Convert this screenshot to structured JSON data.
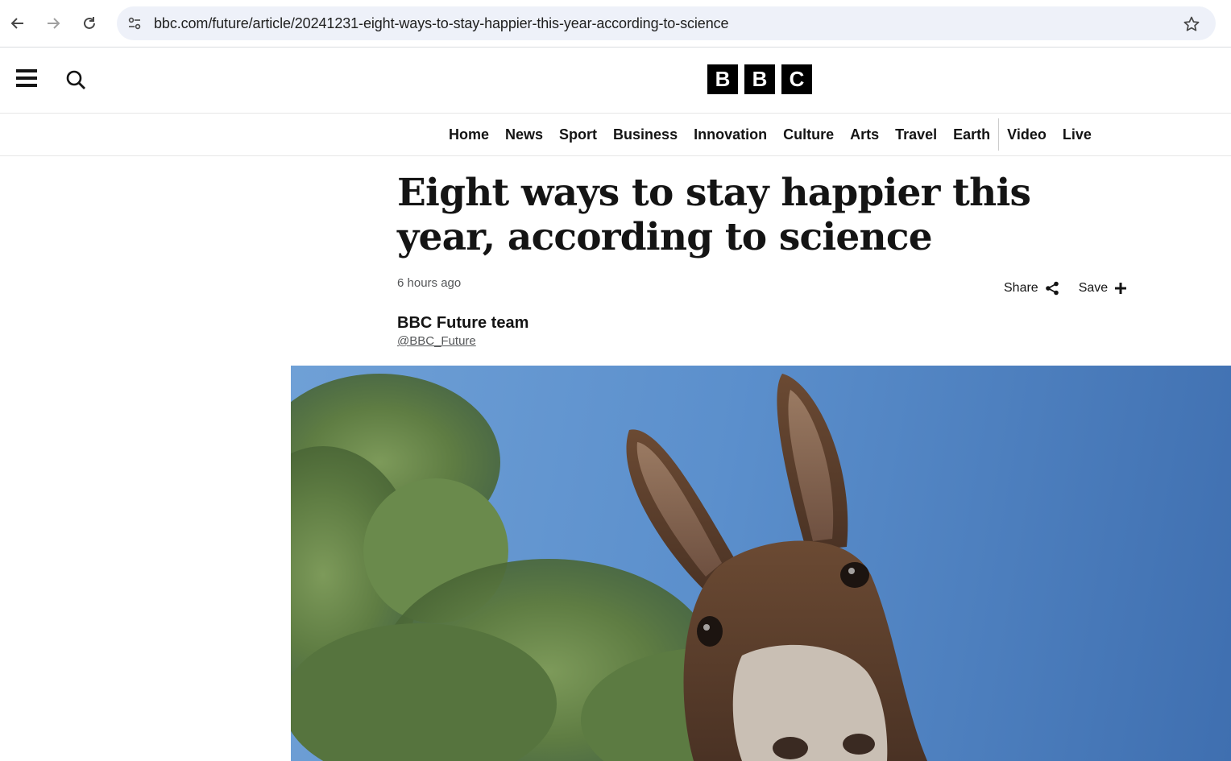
{
  "browser": {
    "url": "bbc.com/future/article/20241231-eight-ways-to-stay-happier-this-year-according-to-science",
    "icons": [
      "back-arrow-icon",
      "forward-arrow-icon",
      "reload-icon",
      "site-info-icon",
      "bookmark-star-icon"
    ]
  },
  "header": {
    "logo_letters": [
      "B",
      "B",
      "C"
    ],
    "icons": [
      "hamburger-menu-icon",
      "search-icon"
    ]
  },
  "nav": {
    "items": [
      "Home",
      "News",
      "Sport",
      "Business",
      "Innovation",
      "Culture",
      "Arts",
      "Travel",
      "Earth",
      "Video",
      "Live"
    ]
  },
  "article": {
    "headline": "Eight ways to stay happier this year, according to science",
    "timestamp": "6 hours ago",
    "share_label": "Share",
    "save_label": "Save",
    "author": "BBC Future team",
    "author_handle": "@BBC_Future",
    "hero_image_subject": "donkey looking down at the camera against a blue sky with trees"
  },
  "colors": {
    "text": "#141414",
    "muted": "#545658",
    "logo_bg": "#000000",
    "sky": "#5b8fcc"
  }
}
